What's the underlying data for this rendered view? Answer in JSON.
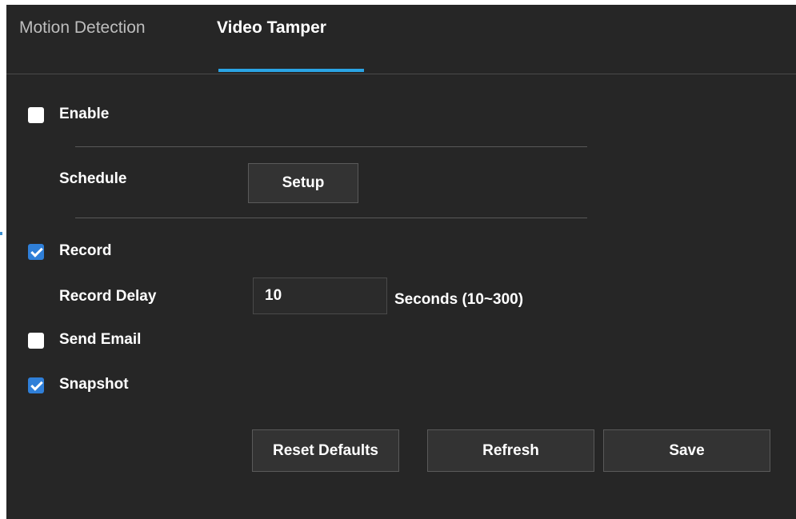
{
  "tabs": [
    {
      "label": "Motion Detection",
      "active": false
    },
    {
      "label": "Video Tamper",
      "active": true
    }
  ],
  "accent_color": "#2aa4e4",
  "form": {
    "enable": {
      "label": "Enable",
      "checked": false
    },
    "schedule": {
      "label": "Schedule",
      "button_label": "Setup"
    },
    "record": {
      "label": "Record",
      "checked": true
    },
    "record_delay": {
      "label": "Record Delay",
      "value": "10",
      "unit": "Seconds (10~300)"
    },
    "send_email": {
      "label": "Send Email",
      "checked": false
    },
    "snapshot": {
      "label": "Snapshot",
      "checked": true
    }
  },
  "actions": {
    "reset_label": "Reset Defaults",
    "refresh_label": "Refresh",
    "save_label": "Save"
  }
}
